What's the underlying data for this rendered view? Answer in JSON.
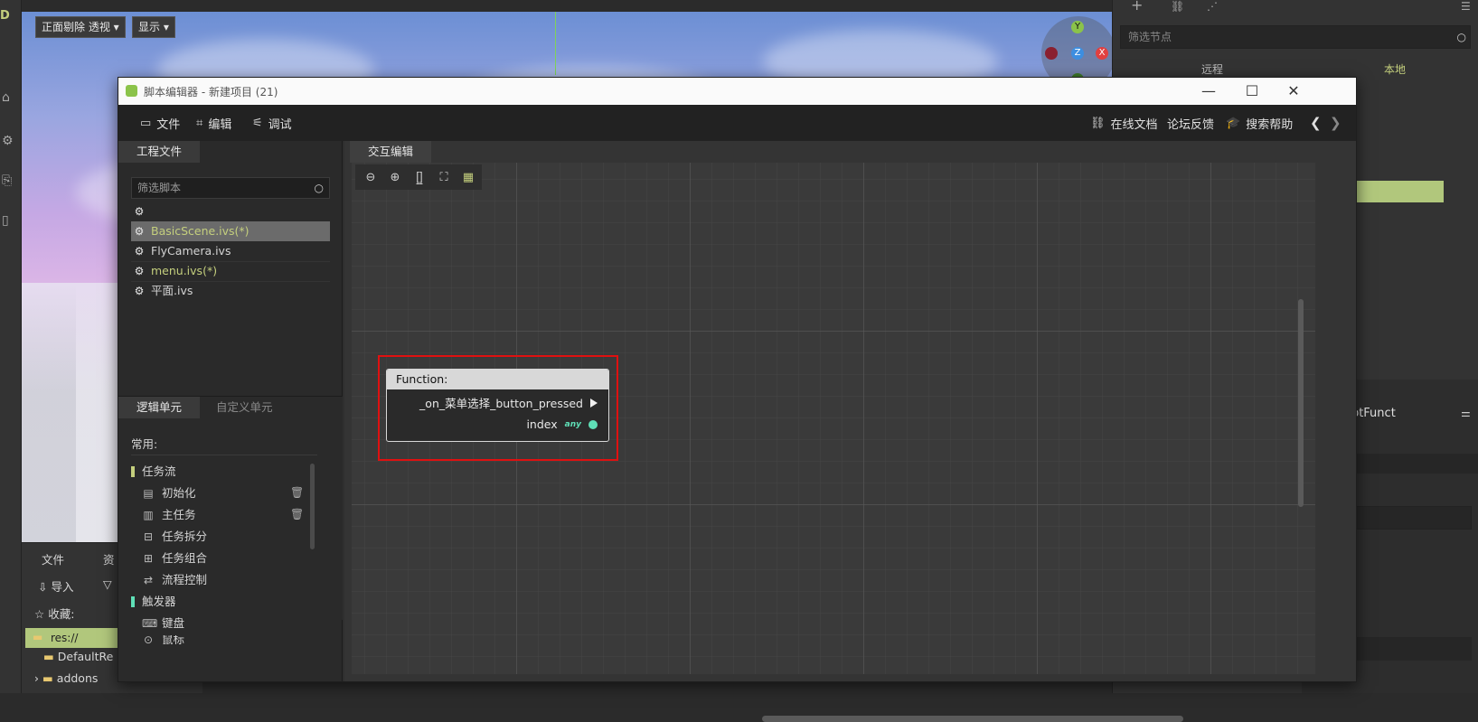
{
  "viewport": {
    "mode_button": "正面剔除 透视",
    "display_button": "显示",
    "gizmo": {
      "y": "Y",
      "z": "Z",
      "x": "X"
    }
  },
  "right_dock": {
    "filter_placeholder": "筛选节点",
    "tab_remote": "远程",
    "tab_local": "本地",
    "class_text": "sualScriptFunct"
  },
  "bottom_dock": {
    "tab_files": "文件",
    "tab_resource": "资",
    "import_label": "导入",
    "favorites_label": "收藏:",
    "res_label": "res://",
    "folder_default": "DefaultRe",
    "folder_addons": "addons"
  },
  "window": {
    "title": "脚本编辑器 - 新建项目 (21)",
    "colors": {
      "accent_green": "#c4cf7d",
      "highlight_red": "#e01010",
      "port_teal": "#5fe0b7"
    }
  },
  "menubar": {
    "file": "文件",
    "edit": "编辑",
    "debug": "调试",
    "online_docs": "在线文档",
    "forum": "论坛反馈",
    "search_help": "搜索帮助"
  },
  "project_files": {
    "tab": "工程文件",
    "filter_placeholder": "筛选脚本",
    "files": [
      {
        "name": "",
        "modified": false
      },
      {
        "name": "BasicScene.ivs(*)",
        "modified": true
      },
      {
        "name": "FlyCamera.ivs",
        "modified": false
      },
      {
        "name": "menu.ivs(*)",
        "modified": true
      },
      {
        "name": "平面.ivs",
        "modified": false
      }
    ]
  },
  "units": {
    "tab_logic": "逻辑单元",
    "tab_custom": "自定义单元",
    "common_label": "常用:",
    "items": [
      {
        "label": "任务流",
        "kind": "category",
        "color": "#c4cf7d"
      },
      {
        "label": "初始化",
        "kind": "item",
        "icon": "clipboard-icon"
      },
      {
        "label": "主任务",
        "kind": "item",
        "icon": "clipboard-check-icon"
      },
      {
        "label": "任务拆分",
        "kind": "item",
        "icon": "split-icon"
      },
      {
        "label": "任务组合",
        "kind": "item",
        "icon": "combine-icon"
      },
      {
        "label": "流程控制",
        "kind": "item",
        "icon": "flow-icon"
      },
      {
        "label": "触发器",
        "kind": "category",
        "color": "#5fe0b7"
      },
      {
        "label": "键盘",
        "kind": "item",
        "icon": "keyboard-icon"
      },
      {
        "label": "鼠标",
        "kind": "item",
        "icon": "mouse-icon"
      }
    ]
  },
  "graph": {
    "tab": "交互编辑",
    "node": {
      "header": "Function:",
      "output_port": "_on_菜单选择_button_pressed",
      "arg_name": "index",
      "arg_type": "any"
    }
  }
}
